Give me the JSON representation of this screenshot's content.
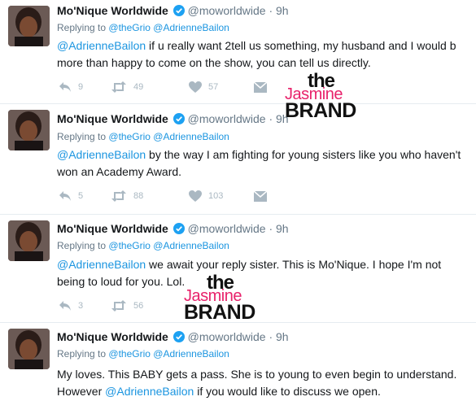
{
  "tweets": [
    {
      "author_name": "Mo'Nique Worldwide",
      "handle": "@moworldwide",
      "dot": "·",
      "time": "9h",
      "replying_prefix": "Replying to",
      "replying_to": [
        "@theGrio",
        "@AdrienneBailon"
      ],
      "body_mention": "@AdrienneBailon",
      "body_text": " if u really want 2tell us something, my husband and I would b more than happy to come on the show, you can tell us directly.",
      "replies": "9",
      "retweets": "49",
      "likes": "57"
    },
    {
      "author_name": "Mo'Nique Worldwide",
      "handle": "@moworldwide",
      "dot": "·",
      "time": "9h",
      "replying_prefix": "Replying to",
      "replying_to": [
        "@theGrio",
        "@AdrienneBailon"
      ],
      "body_mention": "@AdrienneBailon",
      "body_text": " by the way I am fighting for young sisters like you who haven't won an Academy Award.",
      "replies": "5",
      "retweets": "88",
      "likes": "103"
    },
    {
      "author_name": "Mo'Nique Worldwide",
      "handle": "@moworldwide",
      "dot": "·",
      "time": "9h",
      "replying_prefix": "Replying to",
      "replying_to": [
        "@theGrio",
        "@AdrienneBailon"
      ],
      "body_mention": "@AdrienneBailon",
      "body_text": " we await your reply sister. This is Mo'Nique. I hope I'm not being to loud for you. Lol.",
      "replies": "3",
      "retweets": "56",
      "likes": ""
    },
    {
      "author_name": "Mo'Nique Worldwide",
      "handle": "@moworldwide",
      "dot": "·",
      "time": "9h",
      "replying_prefix": "Replying to",
      "replying_to": [
        "@theGrio",
        "@AdrienneBailon"
      ],
      "body_pre": "My loves. This BABY gets a pass. She is to young to even begin to understand. However ",
      "body_mention": "@AdrienneBailon",
      "body_text": " if you would like to discuss we open."
    }
  ],
  "watermark": {
    "the": "the",
    "jasmine": "Jasmine",
    "brand": "BRAND"
  },
  "icons": {
    "reply": "reply-icon",
    "retweet": "retweet-icon",
    "like": "heart-icon",
    "dm": "envelope-icon",
    "verified": "verified-badge-icon"
  },
  "colors": {
    "link": "#1b95e0",
    "muted": "#657786",
    "icon": "#aab8c2",
    "verified": "#1da1f2",
    "watermark_pink": "#e8226b"
  }
}
